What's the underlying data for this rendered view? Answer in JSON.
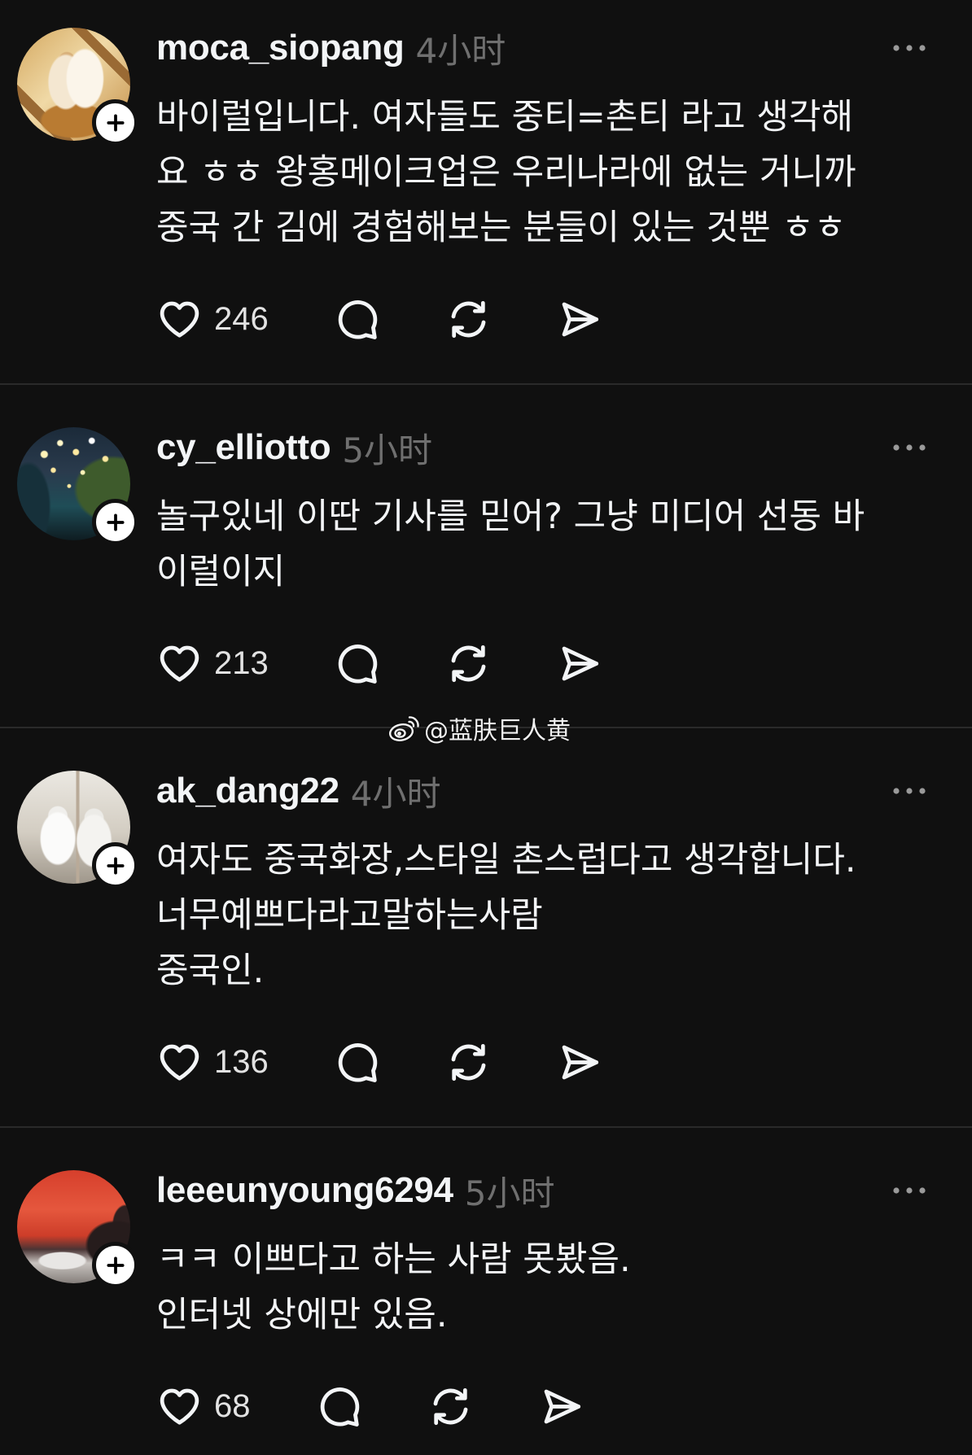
{
  "colors": {
    "background": "#101010",
    "text": "#f3f5f7",
    "secondary": "#6f6f6f",
    "divider": "#2a2a2a"
  },
  "icons": {
    "like": "heart-icon",
    "reply": "comment-icon",
    "repost": "repost-icon",
    "share": "share-icon",
    "more": "more-icon",
    "follow": "plus-icon",
    "watermark": "weibo-icon"
  },
  "watermark": {
    "text": "@蓝肤巨人黄"
  },
  "posts": [
    {
      "username": "moca_siopang",
      "time": "4小时",
      "lines": [
        "바이럴입니다. 여자들도 중티=촌티 라고 생각해",
        "요 ㅎㅎ 왕홍메이크업은 우리나라에 없는 거니까",
        "중국 간 김에 경험해보는 분들이 있는 것뿐 ㅎㅎ"
      ],
      "likes": "246"
    },
    {
      "username": "cy_elliotto",
      "time": "5小时",
      "lines": [
        "놀구있네 이딴 기사를 믿어? 그냥 미디어 선동 바",
        "이럴이지"
      ],
      "likes": "213"
    },
    {
      "username": "ak_dang22",
      "time": "4小时",
      "lines": [
        "여자도 중국화장,스타일 촌스럽다고 생각합니다.",
        "너무예쁘다라고말하는사람",
        "중국인."
      ],
      "likes": "136"
    },
    {
      "username": "leeeunyoung6294",
      "time": "5小时",
      "lines": [
        "ㅋㅋ 이쁘다고 하는 사람 못봤음.",
        "인터넷 상에만 있음."
      ],
      "likes": "68"
    }
  ]
}
